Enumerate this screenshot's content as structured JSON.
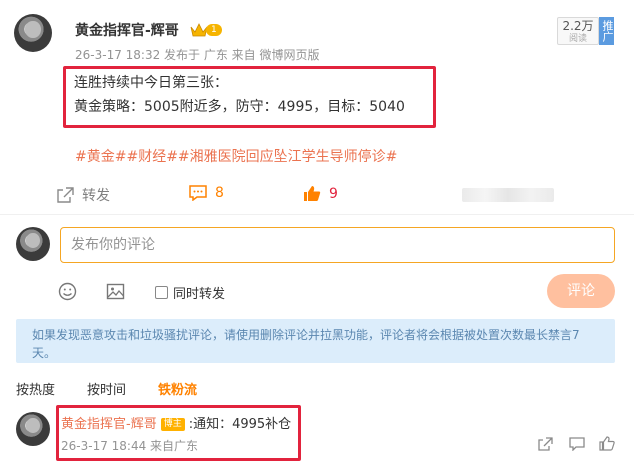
{
  "post": {
    "author": "黄金指挥官-辉哥",
    "crown_level": "1",
    "time_source": "26-3-17 18:32 发布于 广东 来自 微博网页版",
    "views_count": "2.2万",
    "views_label": "阅读",
    "promote_label": "推广",
    "text_line1": "连胜持续中今日第三张：",
    "text_line2": "黄金策略：5005附近多，防守：4995，目标：5040",
    "topics": "#黄金##财经##湘雅医院回应坠江学生导师停诊#",
    "repost_label": "转发",
    "comment_count": "8",
    "like_count": "9"
  },
  "composer": {
    "placeholder": "发布你的评论",
    "same_repost_label": "同时转发",
    "submit_label": "评论"
  },
  "notice": "如果发现恶意攻击和垃圾骚扰评论，请使用删除评论并拉黑功能，评论者将会根据被处置次数最长禁言7天。",
  "tabs": [
    {
      "label": "按热度"
    },
    {
      "label": "按时间"
    },
    {
      "label": "铁粉流"
    }
  ],
  "comment": {
    "author": "黄金指挥官-辉哥",
    "badge": "博主",
    "text": ":通知：4995补仓",
    "time_source": "26-3-17 18:44 来自广东"
  },
  "icons": {
    "repost": "share-icon",
    "comment": "comment-icon",
    "like": "thumbs-up-icon",
    "emoji": "smile-icon",
    "image": "image-icon",
    "crown": "crown-icon"
  },
  "colors": {
    "accent": "#ff8200",
    "topic": "#eb7350",
    "highlight_box": "#e2233d",
    "notice_bg": "#dcedfb"
  }
}
